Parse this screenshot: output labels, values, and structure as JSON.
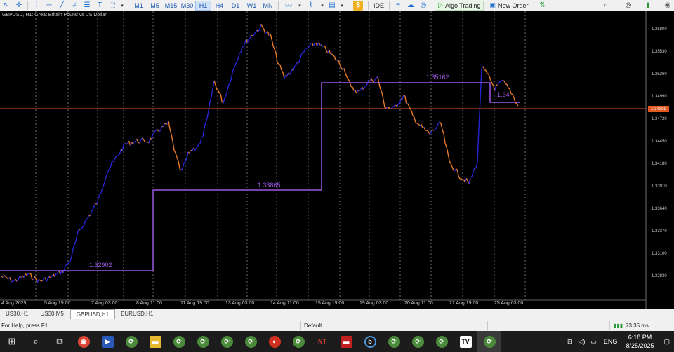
{
  "toolbar": {
    "timeframes": [
      "M1",
      "M5",
      "M15",
      "M30",
      "H1",
      "H4",
      "D1",
      "W1",
      "MN"
    ],
    "active_timeframe": "H1",
    "ide_label": "IDE",
    "algo_label": "Algo Trading",
    "new_order_label": "New Order"
  },
  "chart": {
    "title": "GBPUSD, H1:  Great Britain Pound vs US Dollar",
    "current_price": "1.34399",
    "price_labels": [
      "1.35800",
      "1.35530",
      "1.35260",
      "1.34990",
      "1.34720",
      "1.34450",
      "1.34180",
      "1.33910",
      "1.33640",
      "1.33370",
      "1.33100",
      "1.32830"
    ],
    "time_labels": [
      "4 Aug 2025",
      "5 Aug 19:00",
      "7 Aug 03:00",
      "8 Aug 11:00",
      "11 Aug 19:00",
      "13 Aug 03:00",
      "14 Aug 11:00",
      "15 Aug 19:00",
      "19 Aug 03:00",
      "20 Aug 11:00",
      "21 Aug 19:00",
      "25 Aug 03:00"
    ],
    "step_labels": [
      "1.32902",
      "1.33865",
      "1.35162",
      "1.34"
    ],
    "colors": {
      "up": "#2525d6",
      "down": "#e87b2a",
      "step": "#9b59e0",
      "price_line": "#e05a22",
      "grid": "#d8d8d8"
    }
  },
  "tabs": [
    {
      "label": "US30,H1",
      "active": false
    },
    {
      "label": "US30,M5",
      "active": false
    },
    {
      "label": "GBPUSD,H1",
      "active": true
    },
    {
      "label": "EURUSD,H1",
      "active": false
    }
  ],
  "status": {
    "help": "For Help, press F1",
    "profile": "Default",
    "ping": "73.35 ms"
  },
  "taskbar": {
    "time": "6:18 PM",
    "date": "8/25/2025",
    "lang": "ENG"
  }
}
